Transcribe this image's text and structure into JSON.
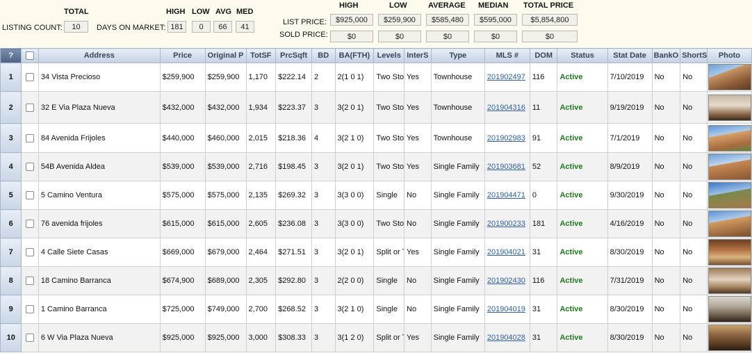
{
  "summary": {
    "total_header": "TOTAL",
    "listing_count_label": "LISTING COUNT:",
    "listing_count": "10",
    "days_label": "DAYS ON MARKET:",
    "days_headers": [
      "HIGH",
      "LOW",
      "AVG",
      "MED"
    ],
    "days_values": [
      "181",
      "0",
      "66",
      "41"
    ],
    "price_headers": [
      "HIGH",
      "LOW",
      "AVERAGE",
      "MEDIAN",
      "TOTAL PRICE"
    ],
    "list_price_label": "LIST PRICE:",
    "list_price_values": [
      "$925,000",
      "$259,900",
      "$585,480",
      "$595,000",
      "$5,854,800"
    ],
    "sold_price_label": "SOLD PRICE:",
    "sold_price_values": [
      "$0",
      "$0",
      "$0",
      "$0",
      "$0"
    ]
  },
  "table": {
    "headers": [
      "?",
      "",
      "Address",
      "Price",
      "Original P",
      "TotSF",
      "PrcSqft",
      "BD",
      "BA(FTH)",
      "Levels",
      "InterS",
      "Type",
      "MLS #",
      "DOM",
      "Status",
      "Stat Date",
      "BankO",
      "ShortS",
      "Photo"
    ],
    "rows": [
      {
        "num": "1",
        "address": "34 Vista Precioso",
        "price": "$259,900",
        "orig": "$259,900",
        "totsf": "1,170",
        "prcsqft": "$222.14",
        "bd": "2",
        "ba": "2(1 0 1)",
        "levels": "Two Story",
        "inter": "Yes",
        "type": "Townhouse",
        "mls": "201902497",
        "dom": "116",
        "status": "Active",
        "statdate": "7/10/2019",
        "banko": "No",
        "shorts": "No"
      },
      {
        "num": "2",
        "address": "32 E Via Plaza Nueva",
        "price": "$432,000",
        "orig": "$432,000",
        "totsf": "1,934",
        "prcsqft": "$223.37",
        "bd": "3",
        "ba": "3(2 0 1)",
        "levels": "Two Story",
        "inter": "Yes",
        "type": "Townhouse",
        "mls": "201904316",
        "dom": "11",
        "status": "Active",
        "statdate": "9/19/2019",
        "banko": "No",
        "shorts": "No"
      },
      {
        "num": "3",
        "address": "84 Avenida Frijoles",
        "price": "$440,000",
        "orig": "$460,000",
        "totsf": "2,015",
        "prcsqft": "$218.36",
        "bd": "4",
        "ba": "3(2 1 0)",
        "levels": "Two Story",
        "inter": "Yes",
        "type": "Townhouse",
        "mls": "201902983",
        "dom": "91",
        "status": "Active",
        "statdate": "7/1/2019",
        "banko": "No",
        "shorts": "No"
      },
      {
        "num": "4",
        "address": "54B Avenida Aldea",
        "price": "$539,000",
        "orig": "$539,000",
        "totsf": "2,716",
        "prcsqft": "$198.45",
        "bd": "3",
        "ba": "3(2 0 1)",
        "levels": "Two Story",
        "inter": "Yes",
        "type": "Single Family",
        "mls": "201903681",
        "dom": "52",
        "status": "Active",
        "statdate": "8/9/2019",
        "banko": "No",
        "shorts": "No"
      },
      {
        "num": "5",
        "address": "5 Camino Ventura",
        "price": "$575,000",
        "orig": "$575,000",
        "totsf": "2,135",
        "prcsqft": "$269.32",
        "bd": "3",
        "ba": "3(3 0 0)",
        "levels": "Single",
        "inter": "No",
        "type": "Single Family",
        "mls": "201904471",
        "dom": "0",
        "status": "Active",
        "statdate": "9/30/2019",
        "banko": "No",
        "shorts": "No"
      },
      {
        "num": "6",
        "address": "76 avenida frijoles",
        "price": "$615,000",
        "orig": "$615,000",
        "totsf": "2,605",
        "prcsqft": "$236.08",
        "bd": "3",
        "ba": "3(3 0 0)",
        "levels": "Two Story",
        "inter": "No",
        "type": "Single Family",
        "mls": "201900233",
        "dom": "181",
        "status": "Active",
        "statdate": "4/16/2019",
        "banko": "No",
        "shorts": "No"
      },
      {
        "num": "7",
        "address": "4 Calle Siete Casas",
        "price": "$669,000",
        "orig": "$679,000",
        "totsf": "2,464",
        "prcsqft": "$271.51",
        "bd": "3",
        "ba": "3(2 0 1)",
        "levels": "Split or Tri",
        "inter": "Yes",
        "type": "Single Family",
        "mls": "201904021",
        "dom": "31",
        "status": "Active",
        "statdate": "8/30/2019",
        "banko": "No",
        "shorts": "No"
      },
      {
        "num": "8",
        "address": "18 Camino Barranca",
        "price": "$674,900",
        "orig": "$689,000",
        "totsf": "2,305",
        "prcsqft": "$292.80",
        "bd": "3",
        "ba": "2(2 0 0)",
        "levels": "Single",
        "inter": "No",
        "type": "Single Family",
        "mls": "201902430",
        "dom": "116",
        "status": "Active",
        "statdate": "7/31/2019",
        "banko": "No",
        "shorts": "No"
      },
      {
        "num": "9",
        "address": "1 Camino Barranca",
        "price": "$725,000",
        "orig": "$749,000",
        "totsf": "2,700",
        "prcsqft": "$268.52",
        "bd": "3",
        "ba": "3(2 1 0)",
        "levels": "Single",
        "inter": "No",
        "type": "Single Family",
        "mls": "201904019",
        "dom": "31",
        "status": "Active",
        "statdate": "8/30/2019",
        "banko": "No",
        "shorts": "No"
      },
      {
        "num": "10",
        "address": "6 W Via Plaza Nueva",
        "price": "$925,000",
        "orig": "$925,000",
        "totsf": "3,000",
        "prcsqft": "$308.33",
        "bd": "3",
        "ba": "3(1 2 0)",
        "levels": "Split or Tri",
        "inter": "Yes",
        "type": "Single Family",
        "mls": "201904028",
        "dom": "31",
        "status": "Active",
        "statdate": "8/30/2019",
        "banko": "No",
        "shorts": "No"
      }
    ]
  },
  "colors": {
    "background": "#fdfbee",
    "header_gradient_top": "#e8eef6",
    "header_text": "#34465c",
    "status_active": "#1f7a1f",
    "link": "#2c5fa6"
  }
}
